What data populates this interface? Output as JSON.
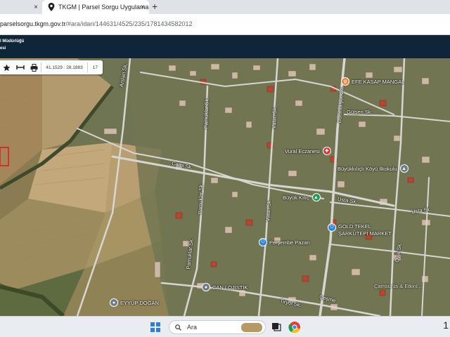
{
  "browser": {
    "tab_inactive_close": "×",
    "tab_active_title": "TKGM | Parsel Sorgu Uygulama",
    "tab_active_close": "×",
    "new_tab": "+",
    "url_main": "parselsorgu.tkgm.gov.tr",
    "url_rest": "/#ara/idari/144631/4525/235/1781434582012"
  },
  "header": {
    "line1": "l Müdürlüğü",
    "line2": "esi"
  },
  "toolbar": {
    "coordinates": "41.1529 : 28.1883",
    "zoom": "17"
  },
  "roads": {
    "arslan": "Arslan Sk.",
    "pamuklar_top": "Pamuklar Sk.",
    "vatan_top": "Vatan Sk.",
    "cumhuriyet": "Cumhuriyet Cd.",
    "gulsen": "Gülşen Sk.",
    "cami": "Cami Sk.",
    "pamuklar_mid": "Pamuklar Sk.",
    "vatan_mid": "Vatan Sk.",
    "usta_left": "Usta Sk.",
    "usta_right": "Usta Sk.",
    "oyal": "Oyal Sk.",
    "pamuklar_bottom": "Pamuklar Sk.",
    "tiryol": "Tiryol Sk.",
    "cesme": "Çeşme"
  },
  "pois": {
    "efe_kasap": "EFE KASAP MANGAL",
    "vural": "Vural Eczanesi",
    "ilkokul": "Büyükkılıçlı Köyü İlkokulu",
    "buyuk_kilic": "Büyük Kılıç",
    "gold_tekel": "GOLD TEKEL",
    "sarkutepi": "ŞARKÜTEPİ MARKET",
    "persembe": "Perşembe Pazarı",
    "can_lojistik": "CAN LOJİSTİK",
    "eyyup": "EYYÜP DOĞAN",
    "watermark": "Çamsürüs & Etkinl..."
  },
  "taskbar": {
    "search_label": "Ara",
    "tray_text": "1"
  },
  "colors": {
    "header_bg": "#0f2639",
    "poi_orange": "#e8863a",
    "poi_red": "#d9363e",
    "poi_green": "#1f9d55",
    "poi_blue": "#2f86d6",
    "poi_gray": "#6d7b86",
    "parcel_outline": "#e01919"
  }
}
